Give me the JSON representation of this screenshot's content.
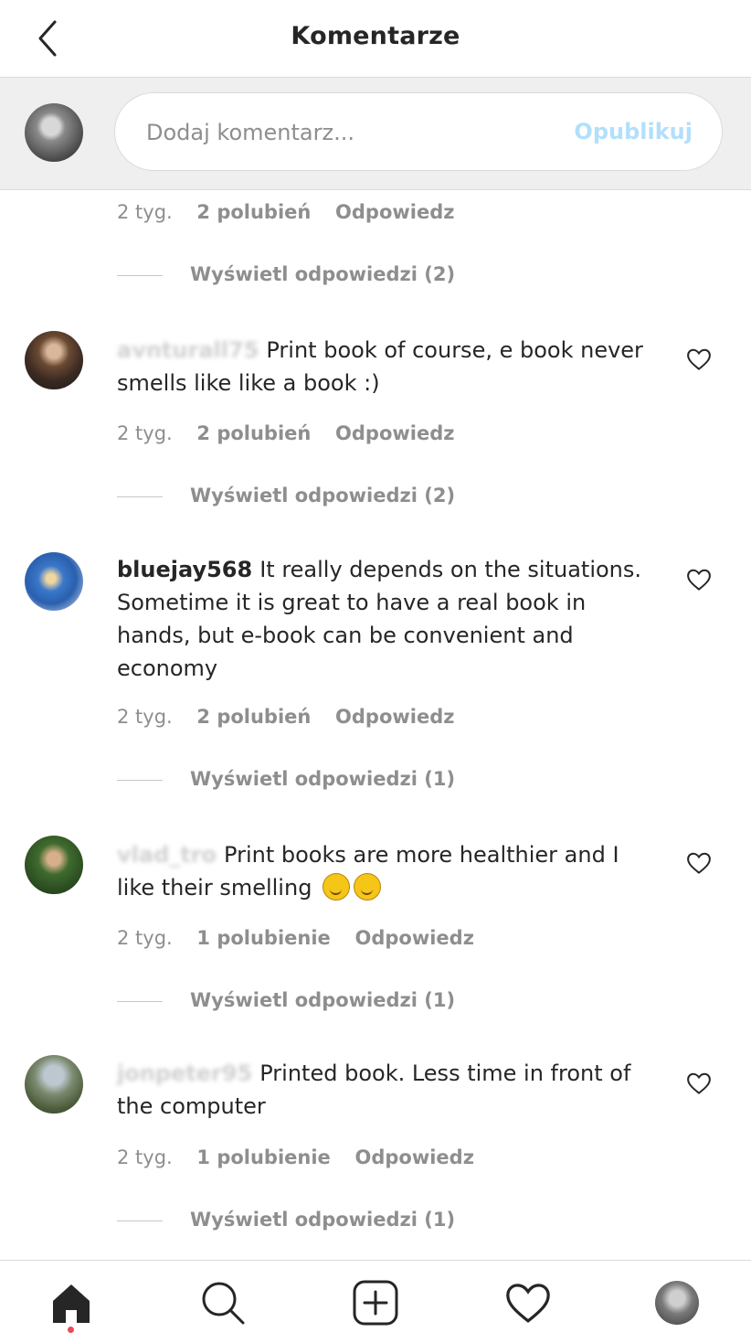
{
  "header": {
    "title": "Komentarze",
    "back_icon": "chevron-left-icon"
  },
  "compose": {
    "placeholder": "Dodaj komentarz...",
    "publish_label": "Opublikuj"
  },
  "top_meta": {
    "time": "2 tyg.",
    "likes": "2 polubień",
    "reply": "Odpowiedz",
    "view_replies": "Wyświetl odpowiedzi (2)"
  },
  "comments": [
    {
      "username": "avnturall75",
      "text": "Print book of course, e book never smells like like a book :)",
      "time": "2 tyg.",
      "likes": "2 polubień",
      "reply": "Odpowiedz",
      "view_replies": "Wyświetl odpowiedzi (2)"
    },
    {
      "username": "bluejay568",
      "text": "It really depends on the situations. Sometime it is great to have a real book in hands, but e-book can be convenient and economy",
      "time": "2 tyg.",
      "likes": "2 polubień",
      "reply": "Odpowiedz",
      "view_replies": "Wyświetl odpowiedzi (1)"
    },
    {
      "username": "vlad_tro",
      "text": "Print books are more healthier and I like their smelling",
      "time": "2 tyg.",
      "likes": "1 polubienie",
      "reply": "Odpowiedz",
      "view_replies": "Wyświetl odpowiedzi (1)"
    },
    {
      "username": "jonpeter95",
      "text": "Printed book. Less time in front of the computer",
      "time": "2 tyg.",
      "likes": "1 polubienie",
      "reply": "Odpowiedz",
      "view_replies": "Wyświetl odpowiedzi (1)"
    }
  ],
  "nav": {
    "items": [
      "home-icon",
      "search-icon",
      "new-post-icon",
      "activity-heart-icon",
      "profile-avatar"
    ],
    "notification_color": "#ed4956"
  },
  "colors": {
    "accent_disabled": "#b2dffc",
    "muted": "#8e8e8e",
    "text": "#262626",
    "divider": "#dbdbdb"
  }
}
